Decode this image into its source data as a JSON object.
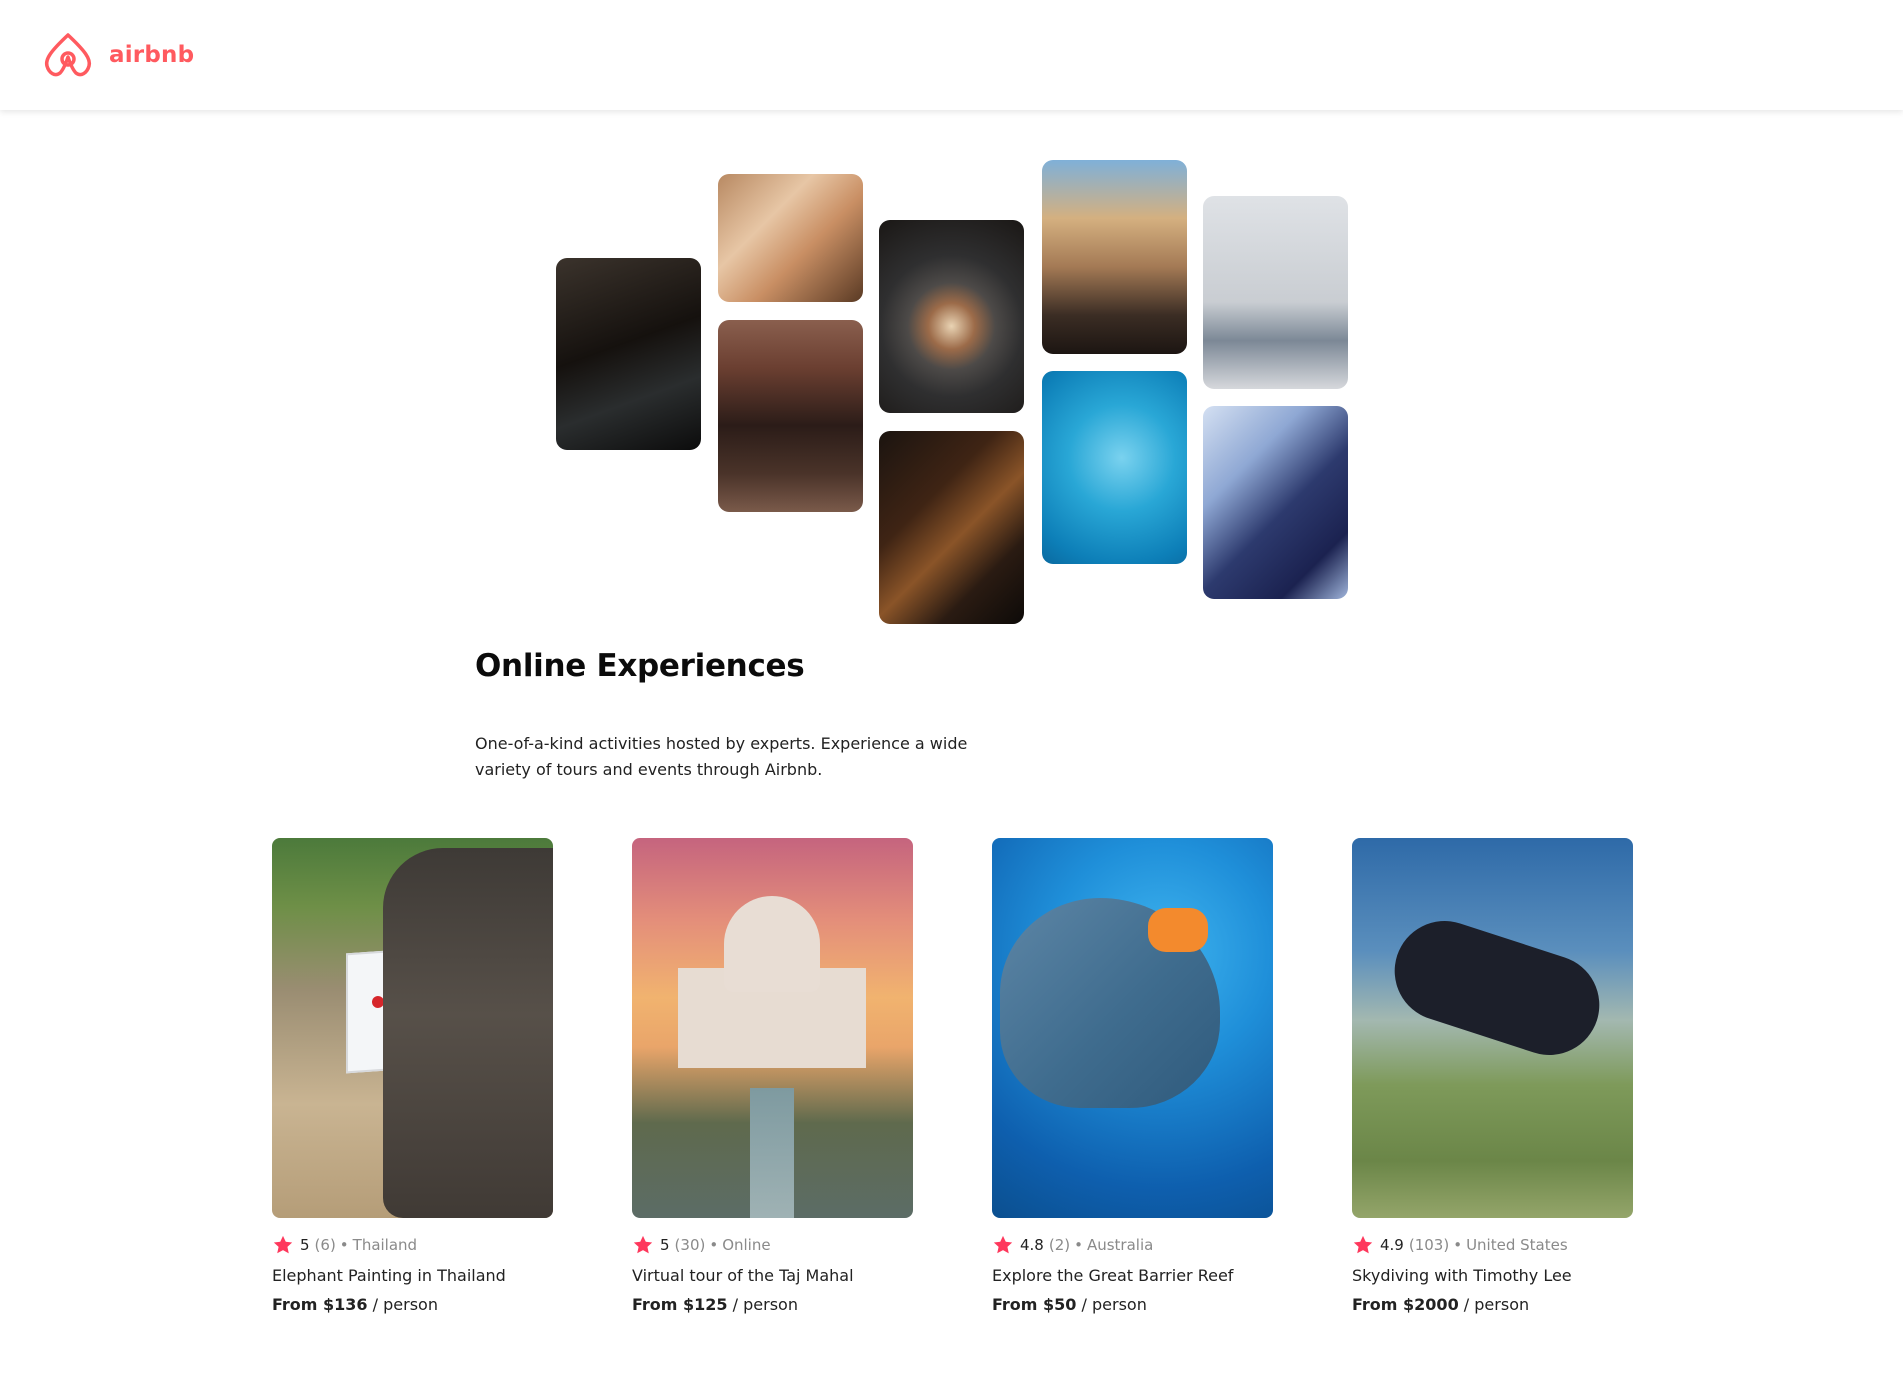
{
  "header": {
    "brand": "airbnb",
    "brand_color": "#FF5A5F"
  },
  "hero": {
    "photos": [
      {
        "subject": "cooking-pans"
      },
      {
        "subject": "woman-with-macarons"
      },
      {
        "subject": "dancer-in-doorway"
      },
      {
        "subject": "stone-bowl-dish"
      },
      {
        "subject": "acoustic-guitar"
      },
      {
        "subject": "piano-and-microphone"
      },
      {
        "subject": "swimmer-in-pool"
      },
      {
        "subject": "woman-meditating"
      },
      {
        "subject": "singer-performing"
      }
    ],
    "title": "Online Experiences",
    "subtitle": "One-of-a-kind activities hosted by experts. Experience a wide variety of tours and events through Airbnb."
  },
  "cards": [
    {
      "rating": "5",
      "reviews": "(6)",
      "separator": "•",
      "location": "Thailand",
      "title": "Elephant Painting in Thailand",
      "price": "From $136",
      "price_suffix": "/ person"
    },
    {
      "rating": "5",
      "reviews": "(30)",
      "separator": "•",
      "location": "Online",
      "title": "Virtual tour of the Taj Mahal",
      "price": "From $125",
      "price_suffix": "/ person"
    },
    {
      "rating": "4.8",
      "reviews": "(2)",
      "separator": "•",
      "location": "Australia",
      "title": "Explore the Great Barrier Reef",
      "price": "From $50",
      "price_suffix": "/ person"
    },
    {
      "rating": "4.9",
      "reviews": "(103)",
      "separator": "•",
      "location": "United States",
      "title": "Skydiving with Timothy Lee",
      "price": "From $2000",
      "price_suffix": "/ person"
    }
  ],
  "star_color": "#FE385C",
  "star_icon": "star-icon"
}
